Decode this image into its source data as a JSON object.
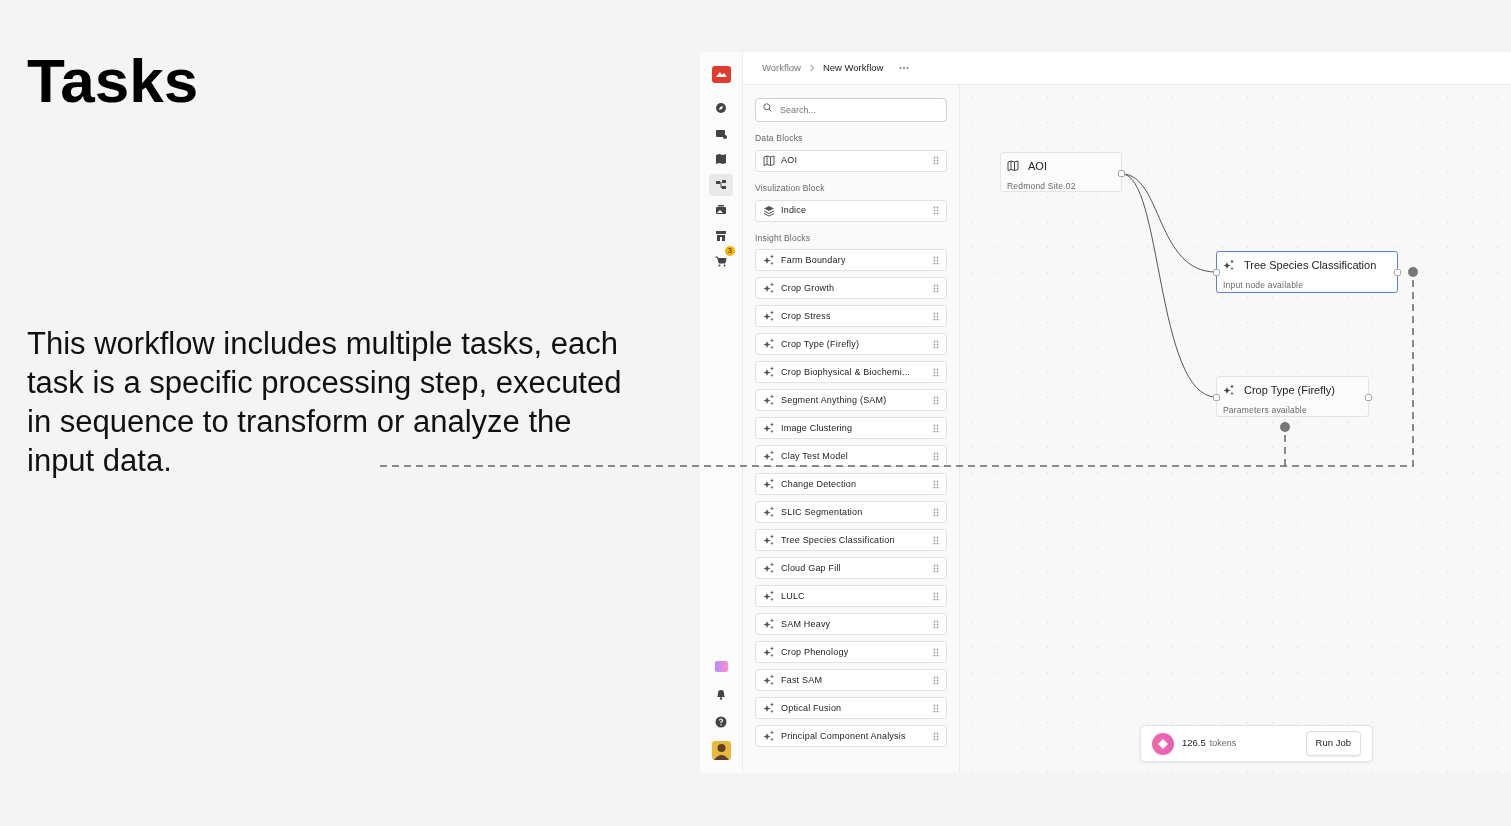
{
  "title": "Tasks",
  "description": "This workflow includes multiple tasks, each task is a specific processing step, executed in sequence to transform or analyze the input data.",
  "app": {
    "rail": [
      {
        "selected": false
      },
      {
        "selected": false
      },
      {
        "selected": false
      },
      {
        "selected": true
      },
      {
        "selected": false
      },
      {
        "selected": false
      },
      {
        "selected": false,
        "badge": "3"
      }
    ],
    "breadcrumb": [
      "Workflow",
      "New Workflow"
    ],
    "search": {
      "placeholder": "Search..."
    },
    "sections": [
      {
        "title": "Data Blocks",
        "kind": "data",
        "blocks": [
          "AOI"
        ]
      },
      {
        "title": "Visulization Block",
        "kind": "visualization",
        "blocks": [
          "Indice"
        ]
      },
      {
        "title": "Insight Blocks",
        "kind": "insight",
        "blocks": [
          "Farm Boundary",
          "Crop Growth",
          "Crop Stress",
          "Crop Type (Firefly)",
          "Crop Biophysical & Biochemi...",
          "Segment Anything (SAM)",
          "Image Clustering",
          "Clay Test Model",
          "Change Detection",
          "SLIC Segmentation",
          "Tree Species Classification",
          "Cloud Gap Fill",
          "LULC",
          "SAM Heavy",
          "Crop Phenology",
          "Fast SAM",
          "Optical Fusion",
          "Principal Component Analysis"
        ]
      }
    ],
    "nodes": [
      {
        "kind": "data",
        "title": "AOI",
        "subtitle": "Redmond Site 02",
        "selected": false
      },
      {
        "kind": "insight",
        "title": "Tree Species Classification",
        "subtitle": "Input node available",
        "selected": true
      },
      {
        "kind": "insight",
        "title": "Crop Type (Firefly)",
        "subtitle": "Parameters available",
        "selected": false
      }
    ],
    "tokens": {
      "amount": "126.5",
      "unit": "tokens"
    },
    "run_button": "Run Job"
  }
}
